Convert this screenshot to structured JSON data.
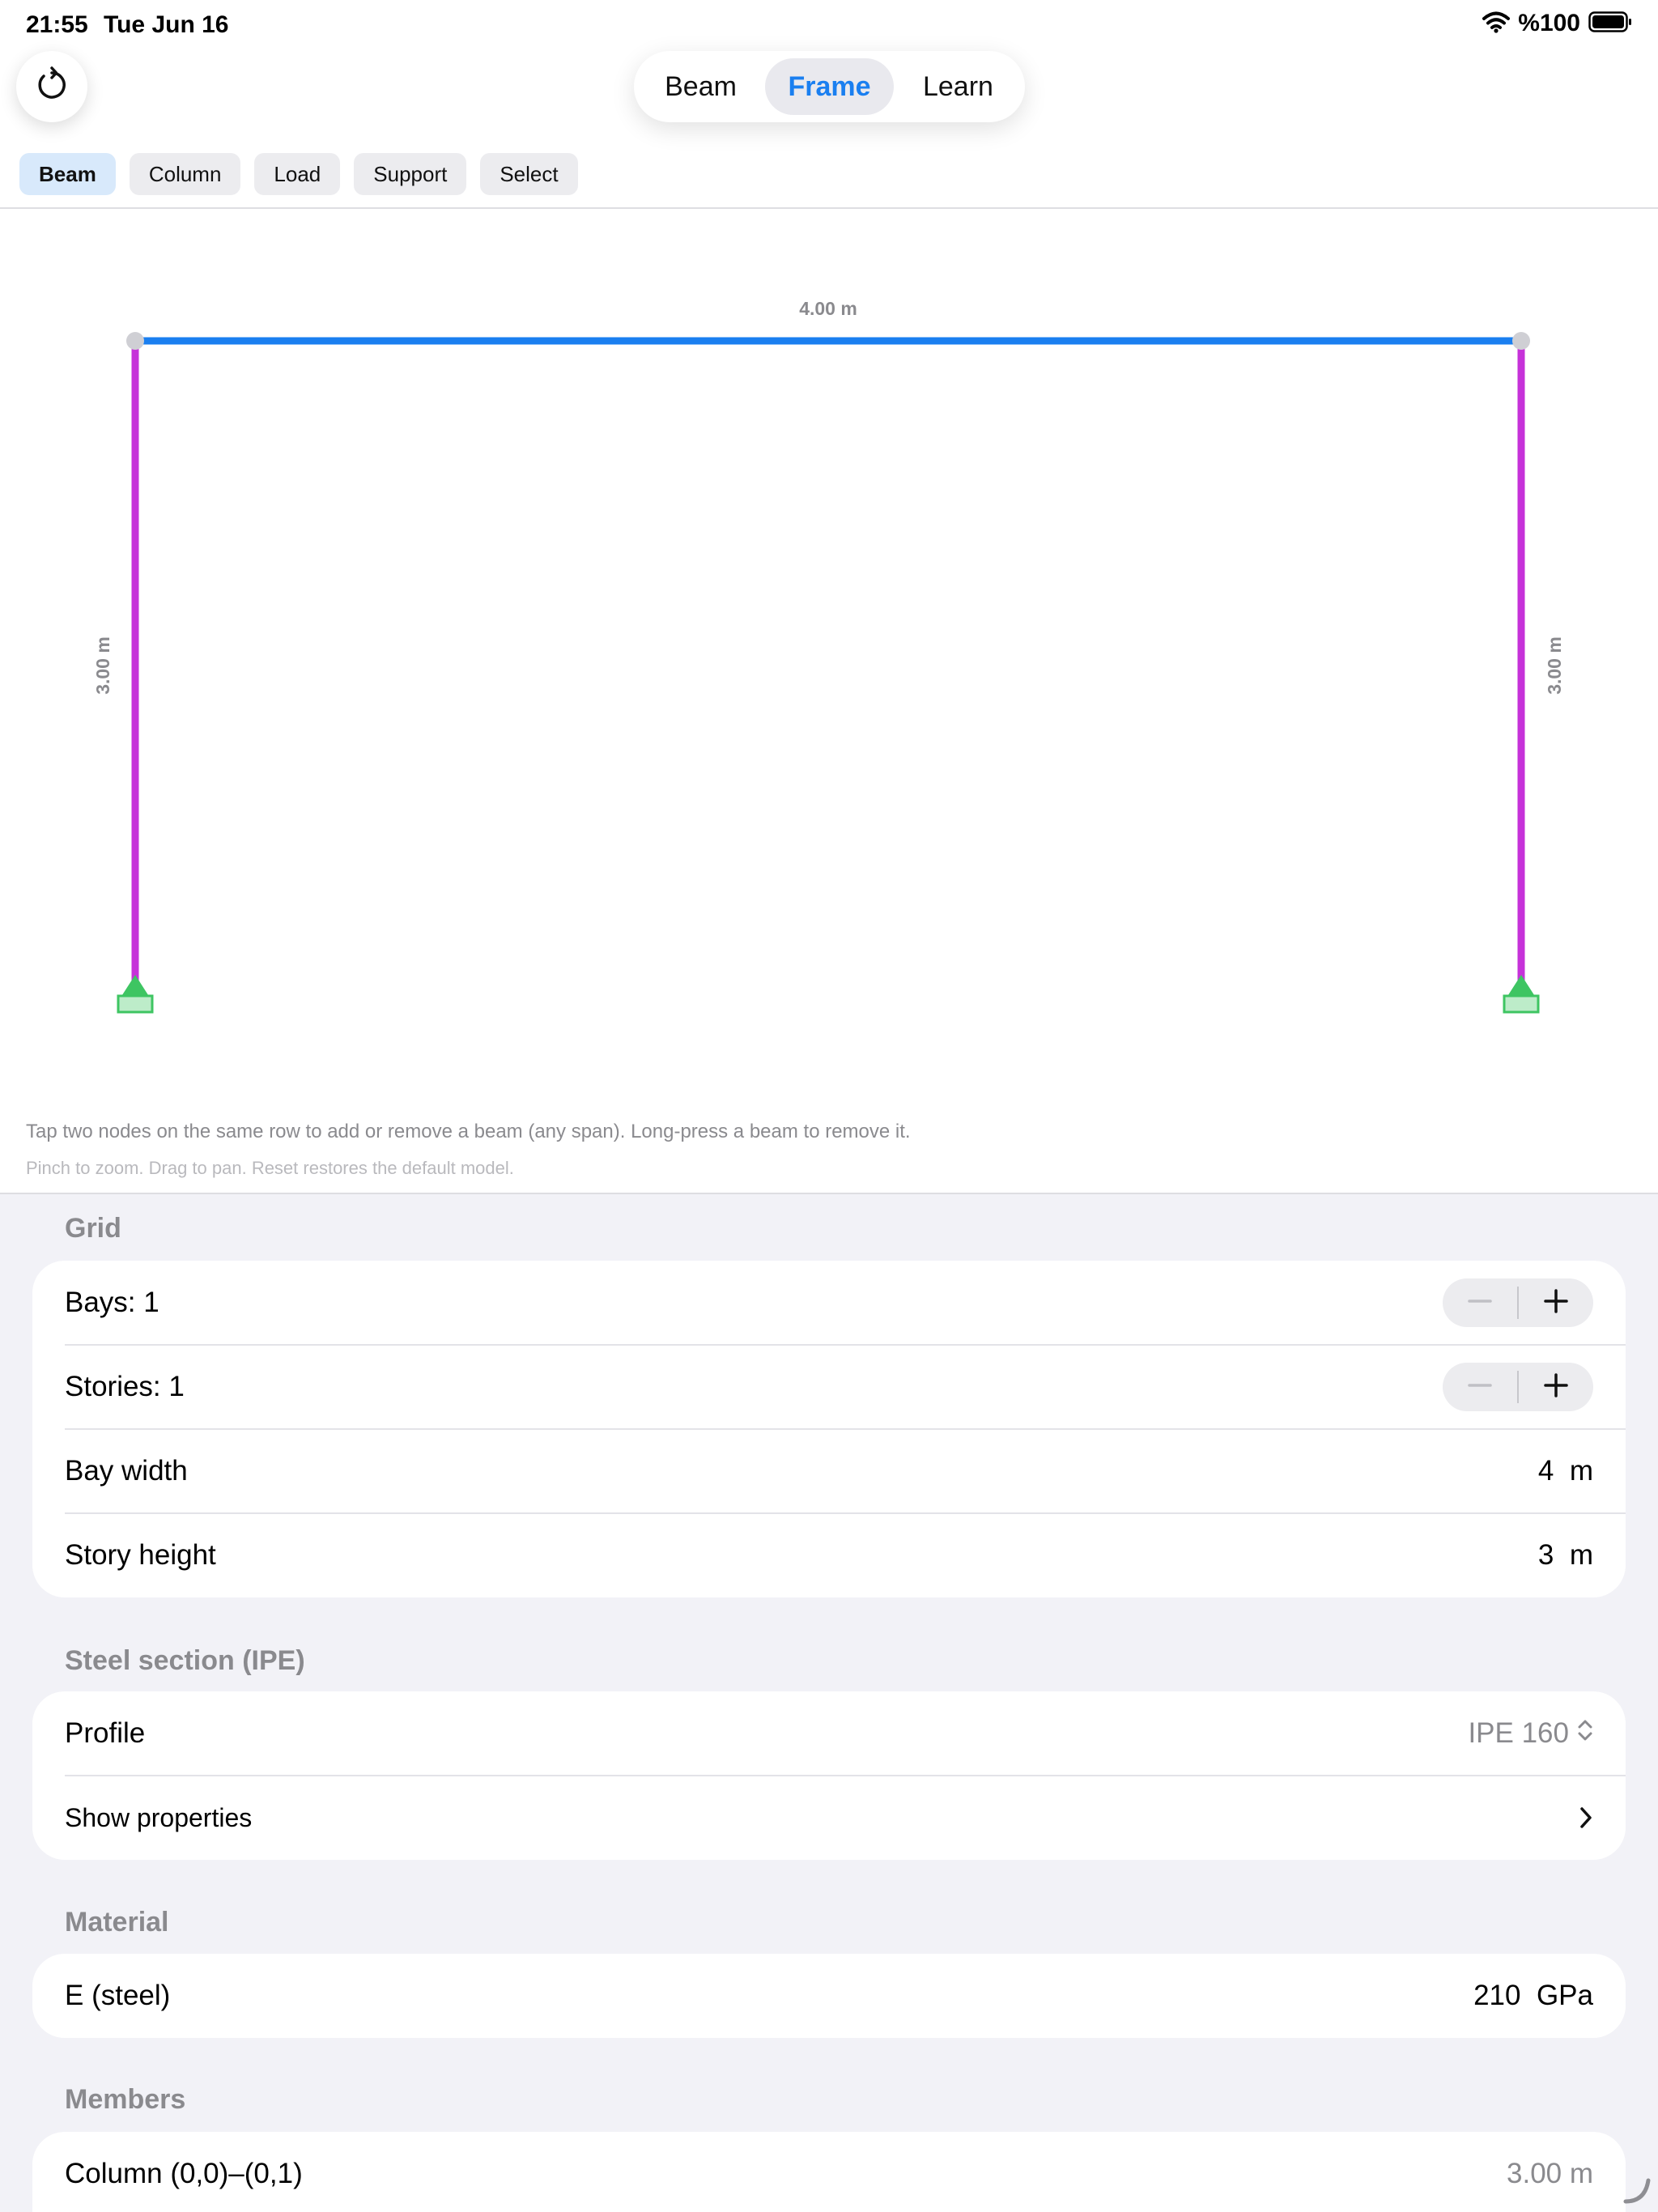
{
  "status": {
    "time": "21:55",
    "date": "Tue Jun 16",
    "battery": "%100"
  },
  "modes": [
    {
      "label": "Beam",
      "active": false
    },
    {
      "label": "Frame",
      "active": true
    },
    {
      "label": "Learn",
      "active": false
    }
  ],
  "tools": [
    {
      "label": "Beam",
      "active": true
    },
    {
      "label": "Column",
      "active": false
    },
    {
      "label": "Load",
      "active": false
    },
    {
      "label": "Support",
      "active": false
    },
    {
      "label": "Select",
      "active": false
    }
  ],
  "frame": {
    "beam_length": "4.00 m",
    "left_column_length": "3.00 m",
    "right_column_length": "3.00 m",
    "colors": {
      "beam": "#1a7ff0",
      "column": "#c632d9",
      "support": "#3ec562",
      "node": "#cfcfd4"
    }
  },
  "hints": {
    "line1": "Tap two nodes on the same row to add or remove a beam (any span). Long-press a beam to remove it.",
    "line2": "Pinch to zoom. Drag to pan. Reset restores the default model."
  },
  "grid": {
    "header": "Grid",
    "bays_label": "Bays: 1",
    "stories_label": "Stories: 1",
    "bay_width_label": "Bay width",
    "bay_width_value": "4",
    "bay_width_unit": "m",
    "story_height_label": "Story height",
    "story_height_value": "3",
    "story_height_unit": "m"
  },
  "steel": {
    "header": "Steel section (IPE)",
    "profile_label": "Profile",
    "profile_value": "IPE 160",
    "show_properties_label": "Show properties"
  },
  "material": {
    "header": "Material",
    "e_label": "E (steel)",
    "e_value": "210",
    "e_unit": "GPa"
  },
  "members": {
    "header": "Members",
    "items": [
      {
        "label": "Column (0,0)–(0,1)",
        "value": "3.00 m"
      }
    ]
  }
}
